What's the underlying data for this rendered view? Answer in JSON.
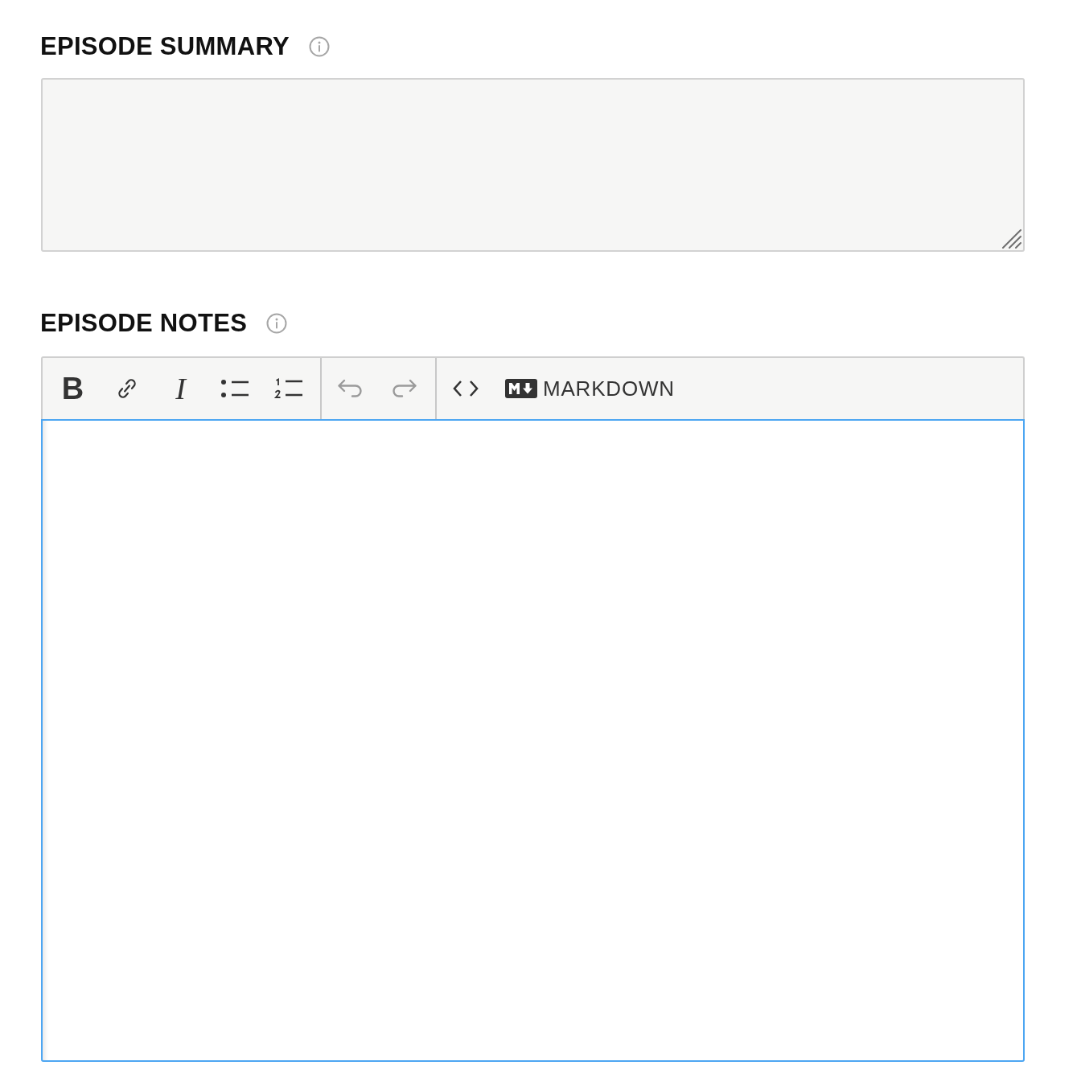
{
  "fields": [
    {
      "kind": "textarea",
      "label": "EPISODE SUMMARY",
      "focused": false
    },
    {
      "kind": "editor",
      "label": "EPISODE NOTES",
      "focused": true,
      "toolbar": [
        {
          "buttons": [
            {
              "kind": "bold",
              "label": "B",
              "disabled": false
            },
            {
              "kind": "link",
              "disabled": false
            },
            {
              "kind": "italic",
              "label": "I",
              "disabled": false
            },
            {
              "kind": "bullet_list",
              "disabled": false
            },
            {
              "kind": "numbered_list",
              "disabled": false
            }
          ]
        },
        {
          "buttons": [
            {
              "kind": "undo",
              "disabled": true
            },
            {
              "kind": "redo",
              "disabled": true
            }
          ]
        },
        {
          "buttons": [
            {
              "kind": "code",
              "disabled": false
            },
            {
              "kind": "markdown",
              "label": "MARKDOWN",
              "disabled": false
            }
          ]
        }
      ]
    }
  ]
}
